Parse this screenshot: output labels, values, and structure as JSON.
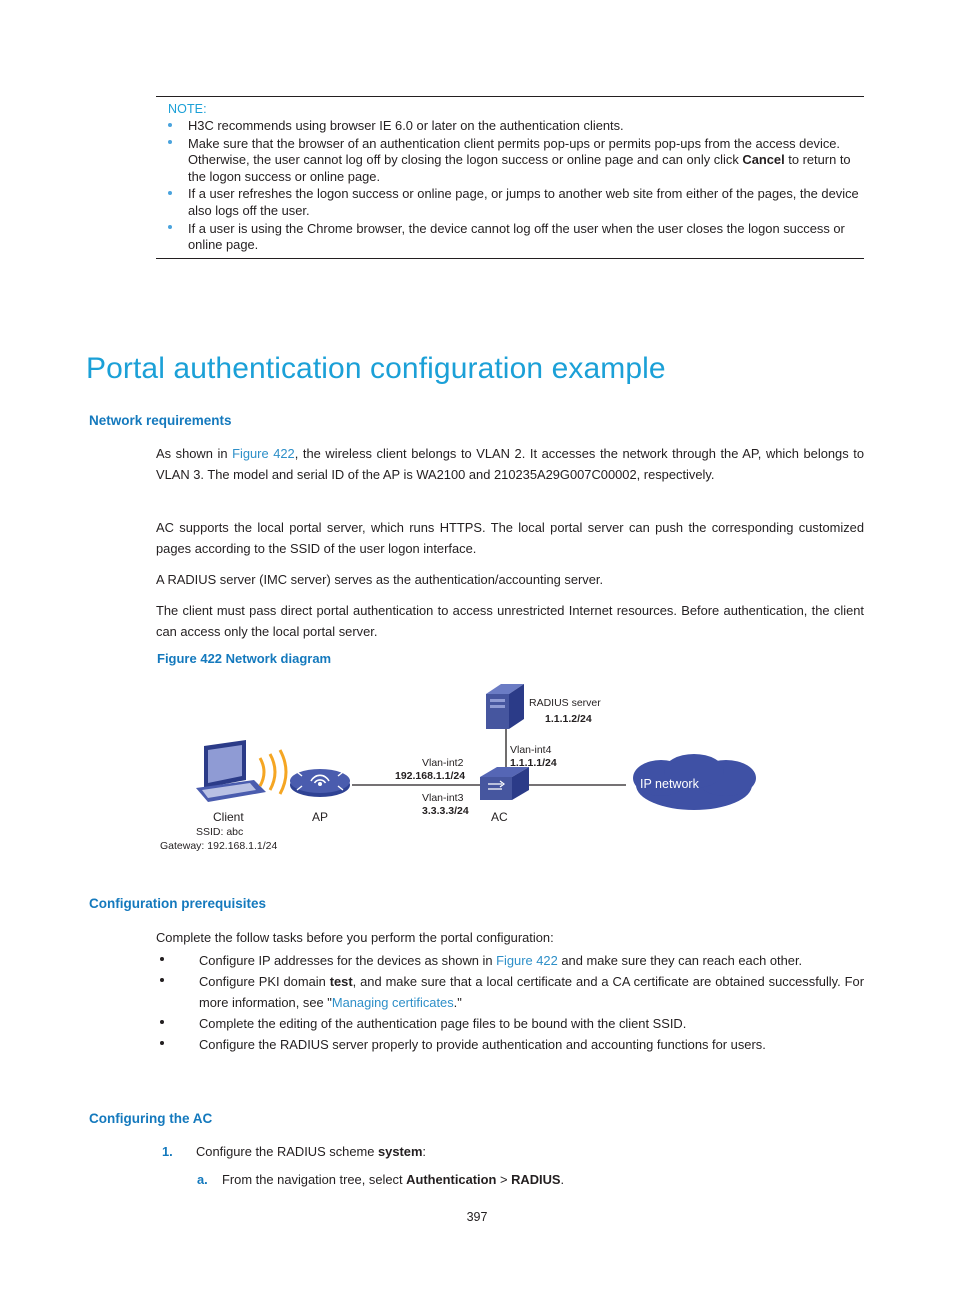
{
  "note": {
    "title": "NOTE:",
    "items": [
      "H3C recommends using browser IE 6.0 or later on the authentication clients.",
      "Make sure that the browser of an authentication client permits pop-ups or permits pop-ups from the access device. Otherwise, the user cannot log off by closing the logon success or online page and can only click Cancel to return to the logon success or online page.",
      "If a user refreshes the logon success or online page, or jumps to another web site from either of the pages, the device also logs off the user.",
      "If a user is using the Chrome browser, the device cannot log off the user when the user closes the logon success or online page."
    ]
  },
  "headings": {
    "h1": "Portal authentication configuration example",
    "network_requirements": "Network requirements",
    "configuration_prerequisites": "Configuration prerequisites",
    "configuring_the_ac": "Configuring the AC"
  },
  "paragraphs": {
    "p1_a": "As shown in ",
    "p1_link": "Figure 422",
    "p1_b": ", the wireless client belongs to VLAN 2. It accesses the network through the AP, which belongs to VLAN 3. The model and serial ID of the AP is WA2100 and 210235A29G007C00002, respectively.",
    "p2": "AC supports the local portal server, which runs HTTPS. The local portal server can push the corresponding customized pages according to the SSID of the user logon interface.",
    "p3": "A RADIUS server (IMC server) serves as the authentication/accounting server.",
    "p4": "The client must pass direct portal authentication to access unrestricted Internet resources. Before authentication, the client can access only the local portal server.",
    "p5": "Complete the follow tasks before you perform the portal configuration:"
  },
  "figure": {
    "caption": "Figure 422 Network diagram",
    "labels": {
      "radius_server": "RADIUS server",
      "radius_ip": "1.1.1.2/24",
      "vlanint4": "Vlan-int4",
      "vlanint4_ip": "1.1.1.1/24",
      "vlanint2": "Vlan-int2",
      "vlanint2_ip": "192.168.1.1/24",
      "vlanint3": "Vlan-int3",
      "vlanint3_ip": "3.3.3.3/24",
      "ip_network": "IP network",
      "ap": "AP",
      "ac": "AC",
      "client": "Client",
      "ssid": "SSID: abc",
      "gateway": "Gateway: 192.168.1.1/24"
    }
  },
  "prereq_items": [
    {
      "a": "Configure IP addresses for the devices as shown in ",
      "link": "Figure 422",
      "b": " and make sure they can reach each other."
    },
    {
      "a": "Configure PKI domain ",
      "bold": "test",
      "b": ", and make sure that a local certificate and a CA certificate are obtained successfully. For more information, see \"",
      "link": "Managing certificates",
      "c": ".\""
    },
    {
      "a": "Complete the editing of the authentication page files to be bound with the client SSID."
    },
    {
      "a": "Configure the RADIUS server properly to provide authentication and accounting functions for users."
    }
  ],
  "numbered": {
    "num1": "1.",
    "item1_a": "Configure the RADIUS scheme ",
    "item1_bold": "system",
    "item1_b": ":",
    "alpha_a": "a.",
    "item1a_a": "From the navigation tree, select ",
    "item1a_bold1": "Authentication",
    "item1a_mid": " > ",
    "item1a_bold2": "RADIUS",
    "item1a_b": "."
  },
  "footer": {
    "page_number": "397"
  },
  "colors": {
    "heading_blue": "#1ba0d7",
    "subheading_blue": "#1479bd",
    "link_blue": "#2e8fc8",
    "note_bullet": "#4aa3dd",
    "device_blue": "#3b4fa0",
    "cloud_blue": "#3f51a5"
  }
}
